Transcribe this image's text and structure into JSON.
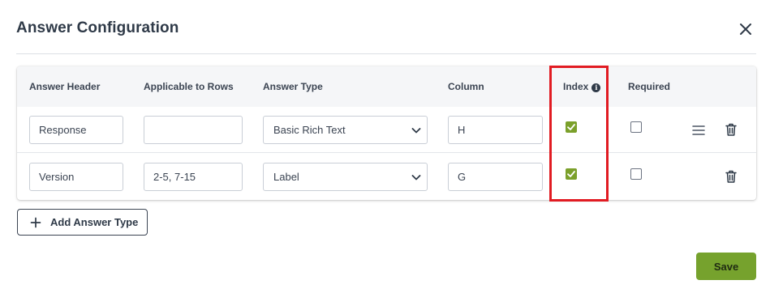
{
  "dialog": {
    "title": "Answer Configuration"
  },
  "table": {
    "headers": {
      "answer_header": "Answer Header",
      "applicable_to_rows": "Applicable to Rows",
      "answer_type": "Answer Type",
      "column": "Column",
      "index": "Index",
      "required": "Required"
    },
    "rows": [
      {
        "answer_header": "Response",
        "applicable_to_rows": "",
        "answer_type": "Basic Rich Text",
        "column": "H",
        "index": true,
        "required": false,
        "has_drag_handle": true
      },
      {
        "answer_header": "Version",
        "applicable_to_rows": "2-5, 7-15",
        "answer_type": "Label",
        "column": "G",
        "index": true,
        "required": false,
        "has_drag_handle": false
      }
    ]
  },
  "actions": {
    "add_answer_type": "Add Answer Type",
    "save": "Save"
  },
  "icons": {
    "close": "close-icon",
    "info": "info-icon",
    "chevron": "chevron-down-icon",
    "drag": "drag-handle-icon",
    "delete": "trash-icon",
    "add": "plus-icon"
  },
  "colors": {
    "accent_green": "#76a22d",
    "checkbox_green": "#7ba02b",
    "highlight_red": "#e11b22"
  }
}
